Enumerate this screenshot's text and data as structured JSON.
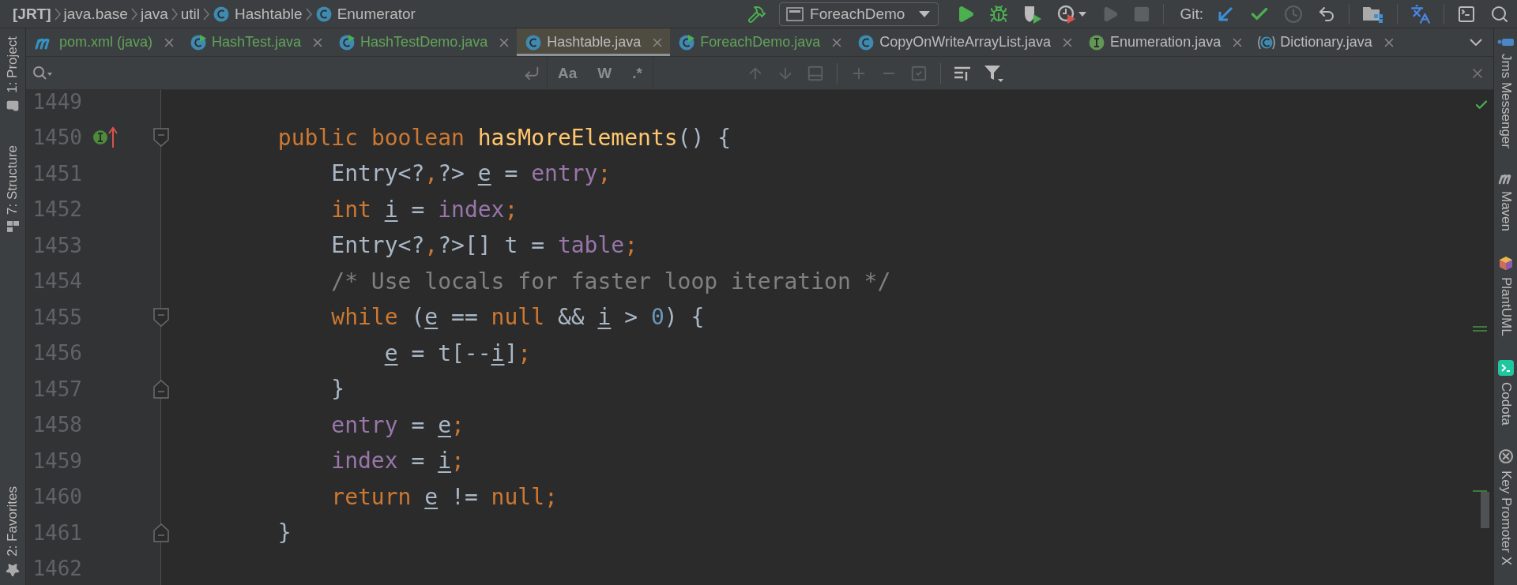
{
  "breadcrumbs": [
    {
      "label": "[JRT]",
      "kind": "root"
    },
    {
      "label": "java.base",
      "kind": "package"
    },
    {
      "label": "java",
      "kind": "package"
    },
    {
      "label": "util",
      "kind": "package"
    },
    {
      "label": "Hashtable",
      "kind": "class"
    },
    {
      "label": "Enumerator",
      "kind": "class"
    }
  ],
  "toolbar": {
    "run_config": "ForeachDemo",
    "vcs_label": "Git:"
  },
  "tool_windows_left": [
    {
      "label": "1: Project",
      "kind": "project"
    },
    {
      "label": "7: Structure",
      "kind": "structure"
    },
    {
      "label": "2: Favorites",
      "kind": "favorites"
    }
  ],
  "tool_windows_right": [
    {
      "label": "Jms Messenger",
      "kind": "jms"
    },
    {
      "label": "Maven",
      "kind": "maven"
    },
    {
      "label": "PlantUML",
      "kind": "plantuml"
    },
    {
      "label": "Codota",
      "kind": "codota"
    },
    {
      "label": "Key Promoter X",
      "kind": "keypromoter"
    }
  ],
  "tabs": [
    {
      "label": "pom.xml (java)",
      "kind": "maven",
      "color": "#62a35a",
      "selected": false
    },
    {
      "label": "HashTest.java",
      "kind": "runnable",
      "color": "#62a35a",
      "selected": false
    },
    {
      "label": "HashTestDemo.java",
      "kind": "runnable",
      "color": "#62a35a",
      "selected": false
    },
    {
      "label": "Hashtable.java",
      "kind": "class",
      "color": "#bbbbbb",
      "selected": true
    },
    {
      "label": "ForeachDemo.java",
      "kind": "runnable",
      "color": "#62a35a",
      "selected": false
    },
    {
      "label": "CopyOnWriteArrayList.java",
      "kind": "class",
      "color": "#bbbbbb",
      "selected": false
    },
    {
      "label": "Enumeration.java",
      "kind": "interface",
      "color": "#bbbbbb",
      "selected": false
    },
    {
      "label": "Dictionary.java",
      "kind": "abstract",
      "color": "#bbbbbb",
      "selected": false
    }
  ],
  "find_options": [
    {
      "label": "Aa"
    },
    {
      "label": "W"
    },
    {
      "label": ".*"
    }
  ],
  "editor": {
    "lines": [
      {
        "number": "1449",
        "fold_start": false,
        "fold_end": false,
        "implements": false
      },
      {
        "number": "1450",
        "fold_start": true,
        "fold_end": false,
        "implements": true,
        "tokens": [
          {
            "text": "        public ",
            "kind": "keyword"
          },
          {
            "text": "boolean ",
            "kind": "keyword"
          },
          {
            "text": "hasMoreElements",
            "kind": "method"
          },
          {
            "text": "() {",
            "kind": "plain"
          }
        ]
      },
      {
        "number": "1451",
        "fold_start": false,
        "fold_end": false,
        "implements": false,
        "tokens": [
          {
            "text": "            Entry<?",
            "kind": "plain"
          },
          {
            "text": ",",
            "kind": "punct"
          },
          {
            "text": "?> ",
            "kind": "plain"
          },
          {
            "text": "e",
            "kind": "local"
          },
          {
            "text": " = ",
            "kind": "plain"
          },
          {
            "text": "entry",
            "kind": "field"
          },
          {
            "text": ";",
            "kind": "punct"
          }
        ]
      },
      {
        "number": "1452",
        "fold_start": false,
        "fold_end": false,
        "implements": false,
        "tokens": [
          {
            "text": "            int ",
            "kind": "keyword"
          },
          {
            "text": "i",
            "kind": "local"
          },
          {
            "text": " = ",
            "kind": "plain"
          },
          {
            "text": "index",
            "kind": "field"
          },
          {
            "text": ";",
            "kind": "punct"
          }
        ]
      },
      {
        "number": "1453",
        "fold_start": false,
        "fold_end": false,
        "implements": false,
        "tokens": [
          {
            "text": "            Entry<?",
            "kind": "plain"
          },
          {
            "text": ",",
            "kind": "punct"
          },
          {
            "text": "?>[] t = ",
            "kind": "plain"
          },
          {
            "text": "table",
            "kind": "field"
          },
          {
            "text": ";",
            "kind": "punct"
          }
        ]
      },
      {
        "number": "1454",
        "fold_start": false,
        "fold_end": false,
        "implements": false,
        "tokens": [
          {
            "text": "            /* Use locals for faster loop iteration */",
            "kind": "comment"
          }
        ]
      },
      {
        "number": "1455",
        "fold_start": true,
        "fold_end": false,
        "implements": false,
        "tokens": [
          {
            "text": "            while",
            "kind": "keyword"
          },
          {
            "text": " (",
            "kind": "plain"
          },
          {
            "text": "e",
            "kind": "local"
          },
          {
            "text": " == ",
            "kind": "plain"
          },
          {
            "text": "null",
            "kind": "keyword"
          },
          {
            "text": " && ",
            "kind": "plain"
          },
          {
            "text": "i",
            "kind": "local"
          },
          {
            "text": " > ",
            "kind": "plain"
          },
          {
            "text": "0",
            "kind": "number"
          },
          {
            "text": ") {",
            "kind": "plain"
          }
        ]
      },
      {
        "number": "1456",
        "fold_start": false,
        "fold_end": false,
        "implements": false,
        "tokens": [
          {
            "text": "                e",
            "kind": "local"
          },
          {
            "text": " = t[--",
            "kind": "plain"
          },
          {
            "text": "i",
            "kind": "local"
          },
          {
            "text": "]",
            "kind": "plain"
          },
          {
            "text": ";",
            "kind": "punct"
          }
        ]
      },
      {
        "number": "1457",
        "fold_start": false,
        "fold_end": true,
        "implements": false,
        "tokens": [
          {
            "text": "            }",
            "kind": "plain"
          }
        ]
      },
      {
        "number": "1458",
        "fold_start": false,
        "fold_end": false,
        "implements": false,
        "tokens": [
          {
            "text": "            entry",
            "kind": "field"
          },
          {
            "text": " = ",
            "kind": "plain"
          },
          {
            "text": "e",
            "kind": "local"
          },
          {
            "text": ";",
            "kind": "punct"
          }
        ]
      },
      {
        "number": "1459",
        "fold_start": false,
        "fold_end": false,
        "implements": false,
        "tokens": [
          {
            "text": "            index",
            "kind": "field"
          },
          {
            "text": " = ",
            "kind": "plain"
          },
          {
            "text": "i",
            "kind": "local"
          },
          {
            "text": ";",
            "kind": "punct"
          }
        ]
      },
      {
        "number": "1460",
        "fold_start": false,
        "fold_end": false,
        "implements": false,
        "tokens": [
          {
            "text": "            return ",
            "kind": "keyword"
          },
          {
            "text": "e",
            "kind": "local"
          },
          {
            "text": " != ",
            "kind": "plain"
          },
          {
            "text": "null",
            "kind": "keyword"
          },
          {
            "text": ";",
            "kind": "punct"
          }
        ]
      },
      {
        "number": "1461",
        "fold_start": false,
        "fold_end": true,
        "implements": false,
        "tokens": [
          {
            "text": "        }",
            "kind": "plain"
          }
        ]
      },
      {
        "number": "1462",
        "fold_start": false,
        "fold_end": false,
        "implements": false
      }
    ]
  }
}
